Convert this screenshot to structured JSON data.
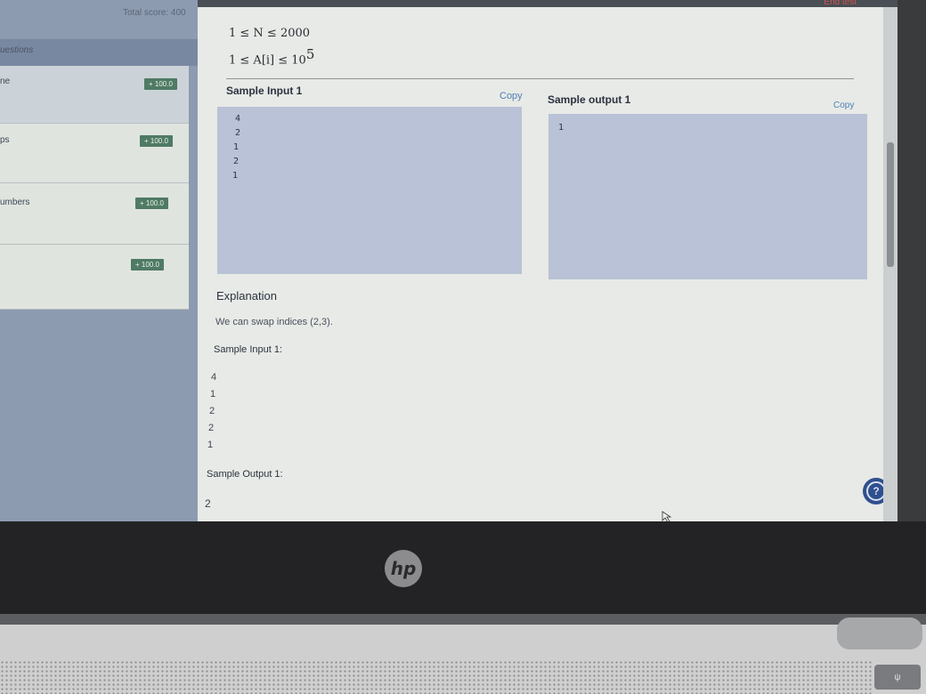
{
  "header": {
    "end_test_label": "End test"
  },
  "sidebar": {
    "total_score": "Total score: 400",
    "questions_label": "uestions",
    "items": [
      {
        "label": "ne",
        "score": "100.0"
      },
      {
        "label": "ps",
        "score": "100.0"
      },
      {
        "label": "umbers",
        "score": "100.0"
      },
      {
        "label": "",
        "score": "100.0"
      }
    ]
  },
  "constraints": [
    "1 ≤ N ≤ 2000",
    "1 ≤ A[i] ≤ 10"
  ],
  "constraint_exponent": "5",
  "sample_input": {
    "title": "Sample Input 1",
    "copy_label": "Copy",
    "lines": [
      "4",
      "2",
      "1",
      "2",
      "1"
    ]
  },
  "sample_output": {
    "title": "Sample output 1",
    "copy_label": "Copy",
    "lines": [
      "1"
    ]
  },
  "explanation": {
    "title": "Explanation",
    "text": "We can swap indices (2,3)."
  },
  "extra_input": {
    "title": "Sample Input 1:",
    "lines": [
      "4",
      "1",
      "2",
      "2",
      "1"
    ]
  },
  "extra_output": {
    "title": "Sample Output 1:",
    "lines": [
      "2"
    ]
  },
  "device": {
    "logo": "hp",
    "power_key_label": "ψ"
  },
  "colors": {
    "accent_link": "#4f7fb8",
    "score_badge": "#4f7a64",
    "help_button": "#2f4f8f",
    "io_box": "#b9c2d6"
  }
}
